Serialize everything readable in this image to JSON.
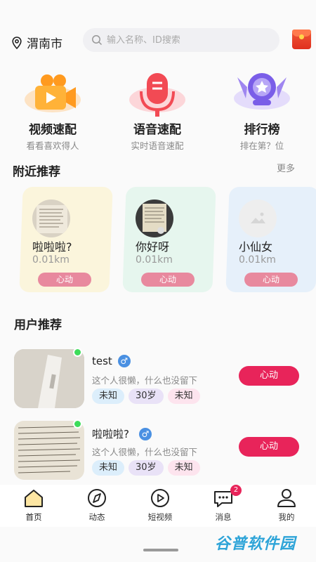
{
  "header": {
    "city": "渭南市",
    "search_placeholder": "输入名称、ID搜索"
  },
  "quick": [
    {
      "title": "视频速配",
      "subtitle": "看看喜欢得人"
    },
    {
      "title": "语音速配",
      "subtitle": "实时语音速配"
    },
    {
      "title": "排行榜",
      "subtitle": "排在第？位"
    }
  ],
  "nearby": {
    "title": "附近推荐",
    "more": "更多",
    "cards": [
      {
        "name": "啦啦啦?",
        "distance": "0.01km",
        "button": "心动",
        "bg": "#fbf5dc"
      },
      {
        "name": "你好呀",
        "distance": "0.01km",
        "button": "心动",
        "bg": "#e6f6ee"
      },
      {
        "name": "小仙女",
        "distance": "0.01km",
        "button": "心动",
        "bg": "#e6f0fa"
      }
    ]
  },
  "users": {
    "title": "用户推荐",
    "items": [
      {
        "name": "test",
        "gender": "♂",
        "bio": "这个人很懒，什么也没留下",
        "tags": [
          "未知",
          "30岁",
          "未知"
        ],
        "button": "心动"
      },
      {
        "name": "啦啦啦?",
        "gender": "♂",
        "bio": "这个人很懒，什么也没留下",
        "tags": [
          "未知",
          "30岁",
          "未知"
        ],
        "button": "心动"
      }
    ]
  },
  "tabbar": {
    "items": [
      {
        "label": "首页"
      },
      {
        "label": "动态"
      },
      {
        "label": "短视频"
      },
      {
        "label": "消息",
        "badge": "2"
      },
      {
        "label": "我的"
      }
    ]
  },
  "watermark": "谷普软件园",
  "colors": {
    "accent": "#e8245a",
    "soft_button": "#e8899e",
    "online": "#3ddc5a",
    "gender_male": "#4a90e2"
  }
}
